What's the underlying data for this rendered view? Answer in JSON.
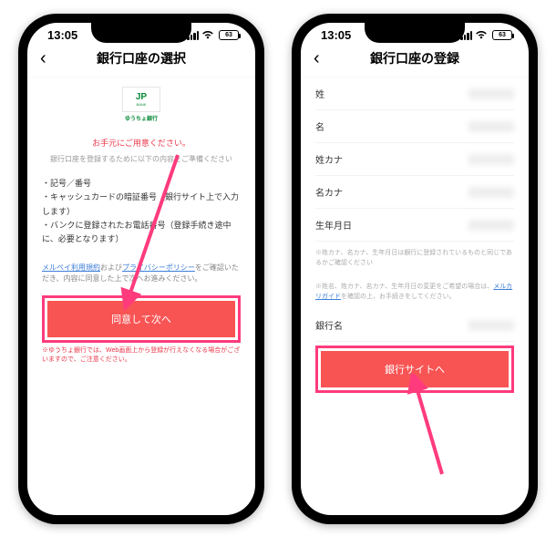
{
  "status": {
    "time": "13:05",
    "battery": "63"
  },
  "left": {
    "title": "銀行口座の選択",
    "bank_name": "ゆうちょ銀行",
    "prep_title": "お手元にご用意ください。",
    "prep_sub": "銀行口座を登録するために以下の内容をご準備ください",
    "items": [
      "・記号／番号",
      "・キャッシュカードの暗証番号（銀行サイト上で入力します）",
      "・バンクに登録されたお電話番号（登録手続き途中に、必要となります）"
    ],
    "consent_prefix": "メルペイ利用規約",
    "consent_mid": "および",
    "consent_link2": "プライバシーポリシー",
    "consent_suffix": "をご確認いただき、内容に同意した上で次へお進みください。",
    "cta": "同意して次へ",
    "warning": "※ゆうちょ銀行では、Web画面上から登録が行えなくなる場合がございますので、ご注意ください。"
  },
  "right": {
    "title": "銀行口座の登録",
    "fields": {
      "lastname": "姓",
      "firstname": "名",
      "lastname_kana": "姓カナ",
      "firstname_kana": "名カナ",
      "birthdate": "生年月日",
      "bankname": "銀行名"
    },
    "note1": "※姓カナ、名カナ、生年月日は銀行に登録されているものと同じであるかご確認ください",
    "note2_a": "※姓名、姓カナ、名カナ、生年月日の変更をご希望の場合は、",
    "note2_link": "メルカリガイド",
    "note2_b": "を確認の上、お手続きをしてください。",
    "cta": "銀行サイトへ"
  }
}
